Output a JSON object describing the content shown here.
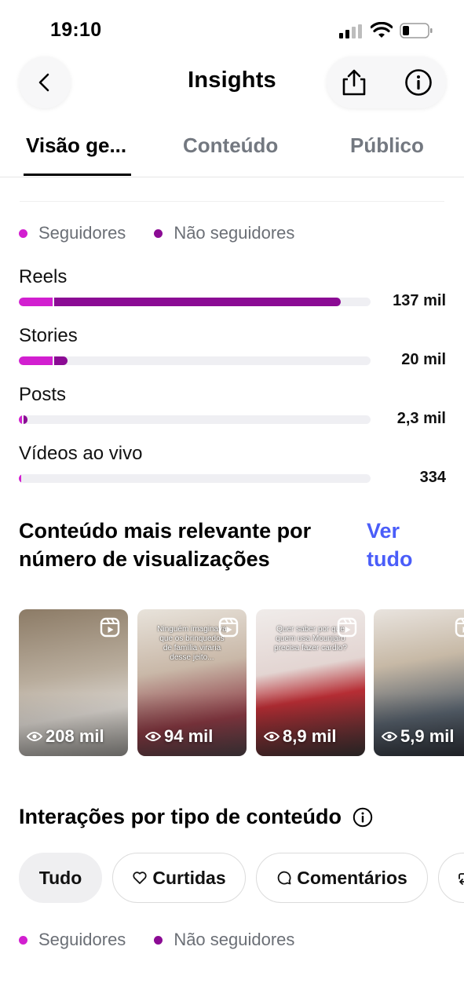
{
  "status_bar": {
    "time": "19:10"
  },
  "header": {
    "title": "Insights"
  },
  "tabs": [
    {
      "label": "Visão ge...",
      "active": true
    },
    {
      "label": "Conteúdo",
      "active": false
    },
    {
      "label": "Público",
      "active": false
    }
  ],
  "legend": {
    "followers": "Seguidores",
    "non_followers": "Não seguidores"
  },
  "colors": {
    "followers": "#d21fd0",
    "non_followers": "#8b0b94",
    "link": "#4a5df9"
  },
  "views_by_type": [
    {
      "label": "Reels",
      "value": "137 mil",
      "followers_fraction": 0.095,
      "non_followers_fraction": 0.815
    },
    {
      "label": "Stories",
      "value": "20 mil",
      "followers_fraction": 0.095,
      "non_followers_fraction": 0.038
    },
    {
      "label": "Posts",
      "value": "2,3 mil",
      "followers_fraction": 0.01,
      "non_followers_fraction": 0.01
    },
    {
      "label": "Vídeos ao vivo",
      "value": "334",
      "followers_fraction": 0.004,
      "non_followers_fraction": 0.0
    }
  ],
  "top_content": {
    "title": "Conteúdo mais relevante por número de visualizações",
    "see_all": "Ver tudo",
    "items": [
      {
        "views": "208 mil",
        "caption": ""
      },
      {
        "views": "94 mil",
        "caption": "Ninguém imaginava que os brinquedos de família viraria desse jeito..."
      },
      {
        "views": "8,9 mil",
        "caption": "Quer saber por que quem usa Mounjaro precisa fazer cardio?"
      },
      {
        "views": "5,9 mil",
        "caption": ""
      }
    ]
  },
  "interactions": {
    "title": "Interações por tipo de conteúdo",
    "filters": [
      {
        "label": "Tudo",
        "icon": "",
        "active": true
      },
      {
        "label": "Curtidas",
        "icon": "heart-icon",
        "active": false
      },
      {
        "label": "Comentários",
        "icon": "comment-icon",
        "active": false
      },
      {
        "label": "",
        "icon": "repost-icon",
        "active": false
      }
    ]
  }
}
